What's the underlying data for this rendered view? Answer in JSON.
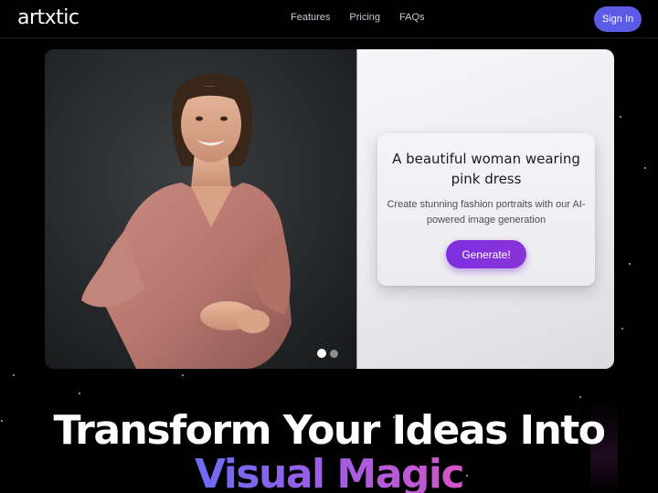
{
  "header": {
    "logo": "artxtic",
    "nav": [
      {
        "label": "Features"
      },
      {
        "label": "Pricing"
      },
      {
        "label": "FAQs"
      }
    ],
    "signin_label": "Sign In"
  },
  "hero": {
    "prompt_title": "A beautiful woman wearing pink dress",
    "prompt_description": "Create stunning fashion portraits with our AI-powered image generation",
    "generate_label": "Generate!",
    "carousel": {
      "count": 2,
      "active_index": 0
    }
  },
  "headline": {
    "line1": "Transform Your Ideas Into",
    "line2": "Visual Magic"
  },
  "colors": {
    "accent": "#5b5be8",
    "generate": "#8330dc",
    "gradient_start": "#6b6cf2",
    "gradient_end": "#d354c8"
  }
}
